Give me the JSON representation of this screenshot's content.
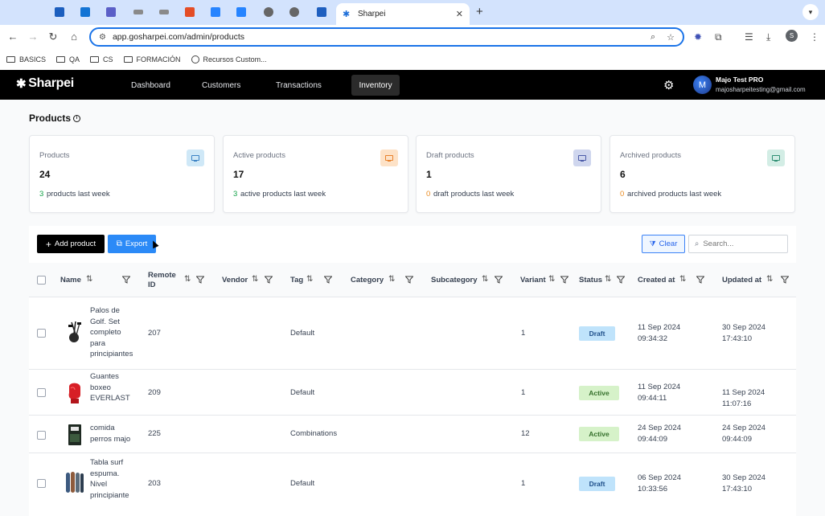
{
  "browser": {
    "active_tab_title": "Sharpei",
    "url": "app.gosharpei.com/admin/products",
    "profile_initial": "S",
    "bookmarks": [
      {
        "label": "BASICS",
        "icon": "folder-icon"
      },
      {
        "label": "QA",
        "icon": "folder-icon"
      },
      {
        "label": "CS",
        "icon": "folder-icon"
      },
      {
        "label": "FORMACIÓN",
        "icon": "folder-icon"
      },
      {
        "label": "Recursos Custom...",
        "icon": "globe-icon"
      }
    ]
  },
  "app": {
    "brand": "Sharpei",
    "nav": [
      "Dashboard",
      "Customers",
      "Transactions",
      "Inventory"
    ],
    "active_nav": "Inventory",
    "user": {
      "initial": "M",
      "name": "Majo Test PRO",
      "email": "majosharpeitesting@gmail.com"
    }
  },
  "page": {
    "title": "Products",
    "cards": [
      {
        "label": "Products",
        "value": "24",
        "delta": "3",
        "delta_text": "products last week",
        "icon_bg": "#cfe8f7",
        "icon_color": "#3b82c4",
        "delta_color": "#16a34a"
      },
      {
        "label": "Active products",
        "value": "17",
        "delta": "3",
        "delta_text": "active products last week",
        "icon_bg": "#fde2c7",
        "icon_color": "#e8812b",
        "delta_color": "#16a34a"
      },
      {
        "label": "Draft products",
        "value": "1",
        "delta": "0",
        "delta_text": "draft products last week",
        "icon_bg": "#cfd6ee",
        "icon_color": "#4b5aa8",
        "delta_color": "#ea8a1f"
      },
      {
        "label": "Archived products",
        "value": "6",
        "delta": "0",
        "delta_text": "archived products last week",
        "icon_bg": "#d3ede5",
        "icon_color": "#2f8f73",
        "delta_color": "#ea8a1f"
      }
    ],
    "actions": {
      "add": "Add product",
      "export": "Export",
      "clear": "Clear",
      "search_placeholder": "Search..."
    },
    "columns": [
      "Name",
      "Remote ID",
      "Vendor",
      "Tag",
      "Category",
      "Subcategory",
      "Variant",
      "Status",
      "Created at",
      "Updated at"
    ],
    "rows": [
      {
        "name": "Palos de Golf. Set completo para principiantes",
        "remote_id": "207",
        "vendor": "",
        "tag": "Default",
        "category": "",
        "subcategory": "",
        "variant": "1",
        "status": "Draft",
        "created": "11 Sep 2024 09:34:32",
        "updated": "30 Sep 2024 17:43:10",
        "image": "golf-clubs-image"
      },
      {
        "name": "Guantes boxeo EVERLAST",
        "remote_id": "209",
        "vendor": "",
        "tag": "Default",
        "category": "",
        "subcategory": "",
        "variant": "1",
        "status": "Active",
        "created": "11 Sep 2024 09:44:11",
        "updated": "11 Sep 2024 11:07:16",
        "image": "boxing-glove-image"
      },
      {
        "name": "comida perros majo",
        "remote_id": "225",
        "vendor": "",
        "tag": "Combinations",
        "category": "",
        "subcategory": "",
        "variant": "12",
        "status": "Active",
        "created": "24 Sep 2024 09:44:09",
        "updated": "24 Sep 2024 09:44:09",
        "image": "dog-food-image"
      },
      {
        "name": "Tabla surf espuma. Nivel principiante",
        "remote_id": "203",
        "vendor": "",
        "tag": "Default",
        "category": "",
        "subcategory": "",
        "variant": "1",
        "status": "Draft",
        "created": "06 Sep 2024 10:33:56",
        "updated": "30 Sep 2024 17:43:10",
        "image": "surfboards-image"
      }
    ]
  }
}
